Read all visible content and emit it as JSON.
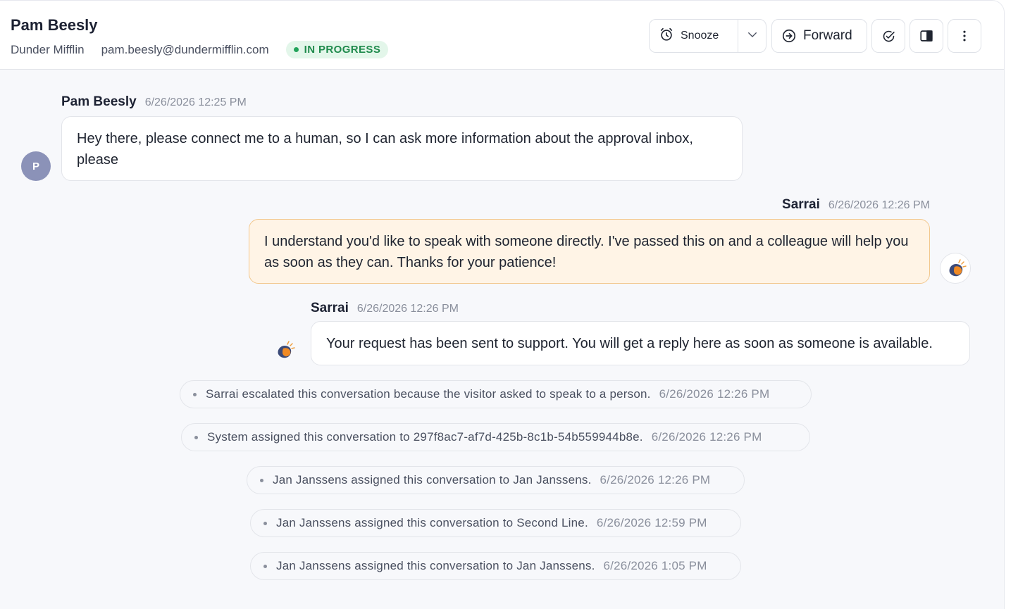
{
  "header": {
    "contact_name": "Pam Beesly",
    "company": "Dunder Mifflin",
    "email": "pam.beesly@dundermifflin.com",
    "status": "IN PROGRESS",
    "status_color": "#1f8a4c"
  },
  "toolbar": {
    "snooze_label": "Snooze",
    "snooze_icon": "alarm-clock-icon",
    "caret_icon": "chevron-down-icon",
    "forward_label": "Forward",
    "forward_icon": "arrow-right-circle-icon",
    "resolve_icon": "check-circle-icon",
    "sidebar_icon": "panel-right-icon",
    "more_icon": "more-vertical-icon"
  },
  "messages": [
    {
      "author": "Pam Beesly",
      "time": "6/26/2026 12:25 PM",
      "text": "Hey there, please connect me to a human, so I can ask more information about the approval inbox, please",
      "avatar_initial": "P"
    },
    {
      "author": "Sarrai",
      "time": "6/26/2026 12:26 PM",
      "text": "I understand you'd like to speak with someone directly. I've passed this on and a colleague will help you as soon as they can. Thanks for your patience!",
      "accent": "#fff4e6"
    },
    {
      "author": "Sarrai",
      "time": "6/26/2026 12:26 PM",
      "text": "Your request has been sent to support. You will get a reply here as soon as someone is available."
    }
  ],
  "events": [
    {
      "text": "Sarrai escalated this conversation because the visitor asked to speak to a person.",
      "time": "6/26/2026 12:26 PM"
    },
    {
      "text": "System assigned this conversation to 297f8ac7-af7d-425b-8c1b-54b559944b8e.",
      "time": "6/26/2026 12:26 PM"
    },
    {
      "text": "Jan Janssens assigned this conversation to Jan Janssens.",
      "time": "6/26/2026 12:26 PM"
    },
    {
      "text": "Jan Janssens assigned this conversation to Second Line.",
      "time": "6/26/2026 12:59 PM"
    },
    {
      "text": "Jan Janssens assigned this conversation to Jan Janssens.",
      "time": "6/26/2026 1:05 PM"
    }
  ]
}
